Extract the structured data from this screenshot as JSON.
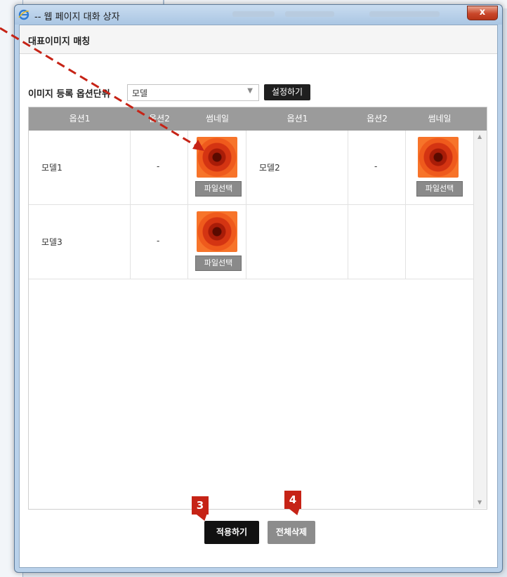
{
  "window": {
    "title": "-- 웹 페이지 대화 상자",
    "close_label": "x"
  },
  "dialog": {
    "header_title": "대표이미지 매칭",
    "option_label": "이미지 등록 옵션단위",
    "option_select_value": "모델",
    "set_button": "설정하기"
  },
  "table": {
    "columns": [
      "옵션1",
      "옵션2",
      "썸네일",
      "옵션1",
      "옵션2",
      "썸네일"
    ],
    "rows": [
      {
        "left": {
          "opt1": "모델1",
          "opt2": "-",
          "file_button": "파일선택"
        },
        "right": {
          "opt1": "모델2",
          "opt2": "-",
          "file_button": "파일선택"
        }
      },
      {
        "left": {
          "opt1": "모델3",
          "opt2": "-",
          "file_button": "파일선택"
        }
      }
    ]
  },
  "footer": {
    "apply_button": "적용하기",
    "clear_button": "전체삭제"
  },
  "callouts": [
    "3",
    "4"
  ],
  "colors": {
    "annotation": "#c62316",
    "header_bg": "#9b9b9b",
    "button_dark": "#111111",
    "button_gray": "#8c8c8c"
  }
}
